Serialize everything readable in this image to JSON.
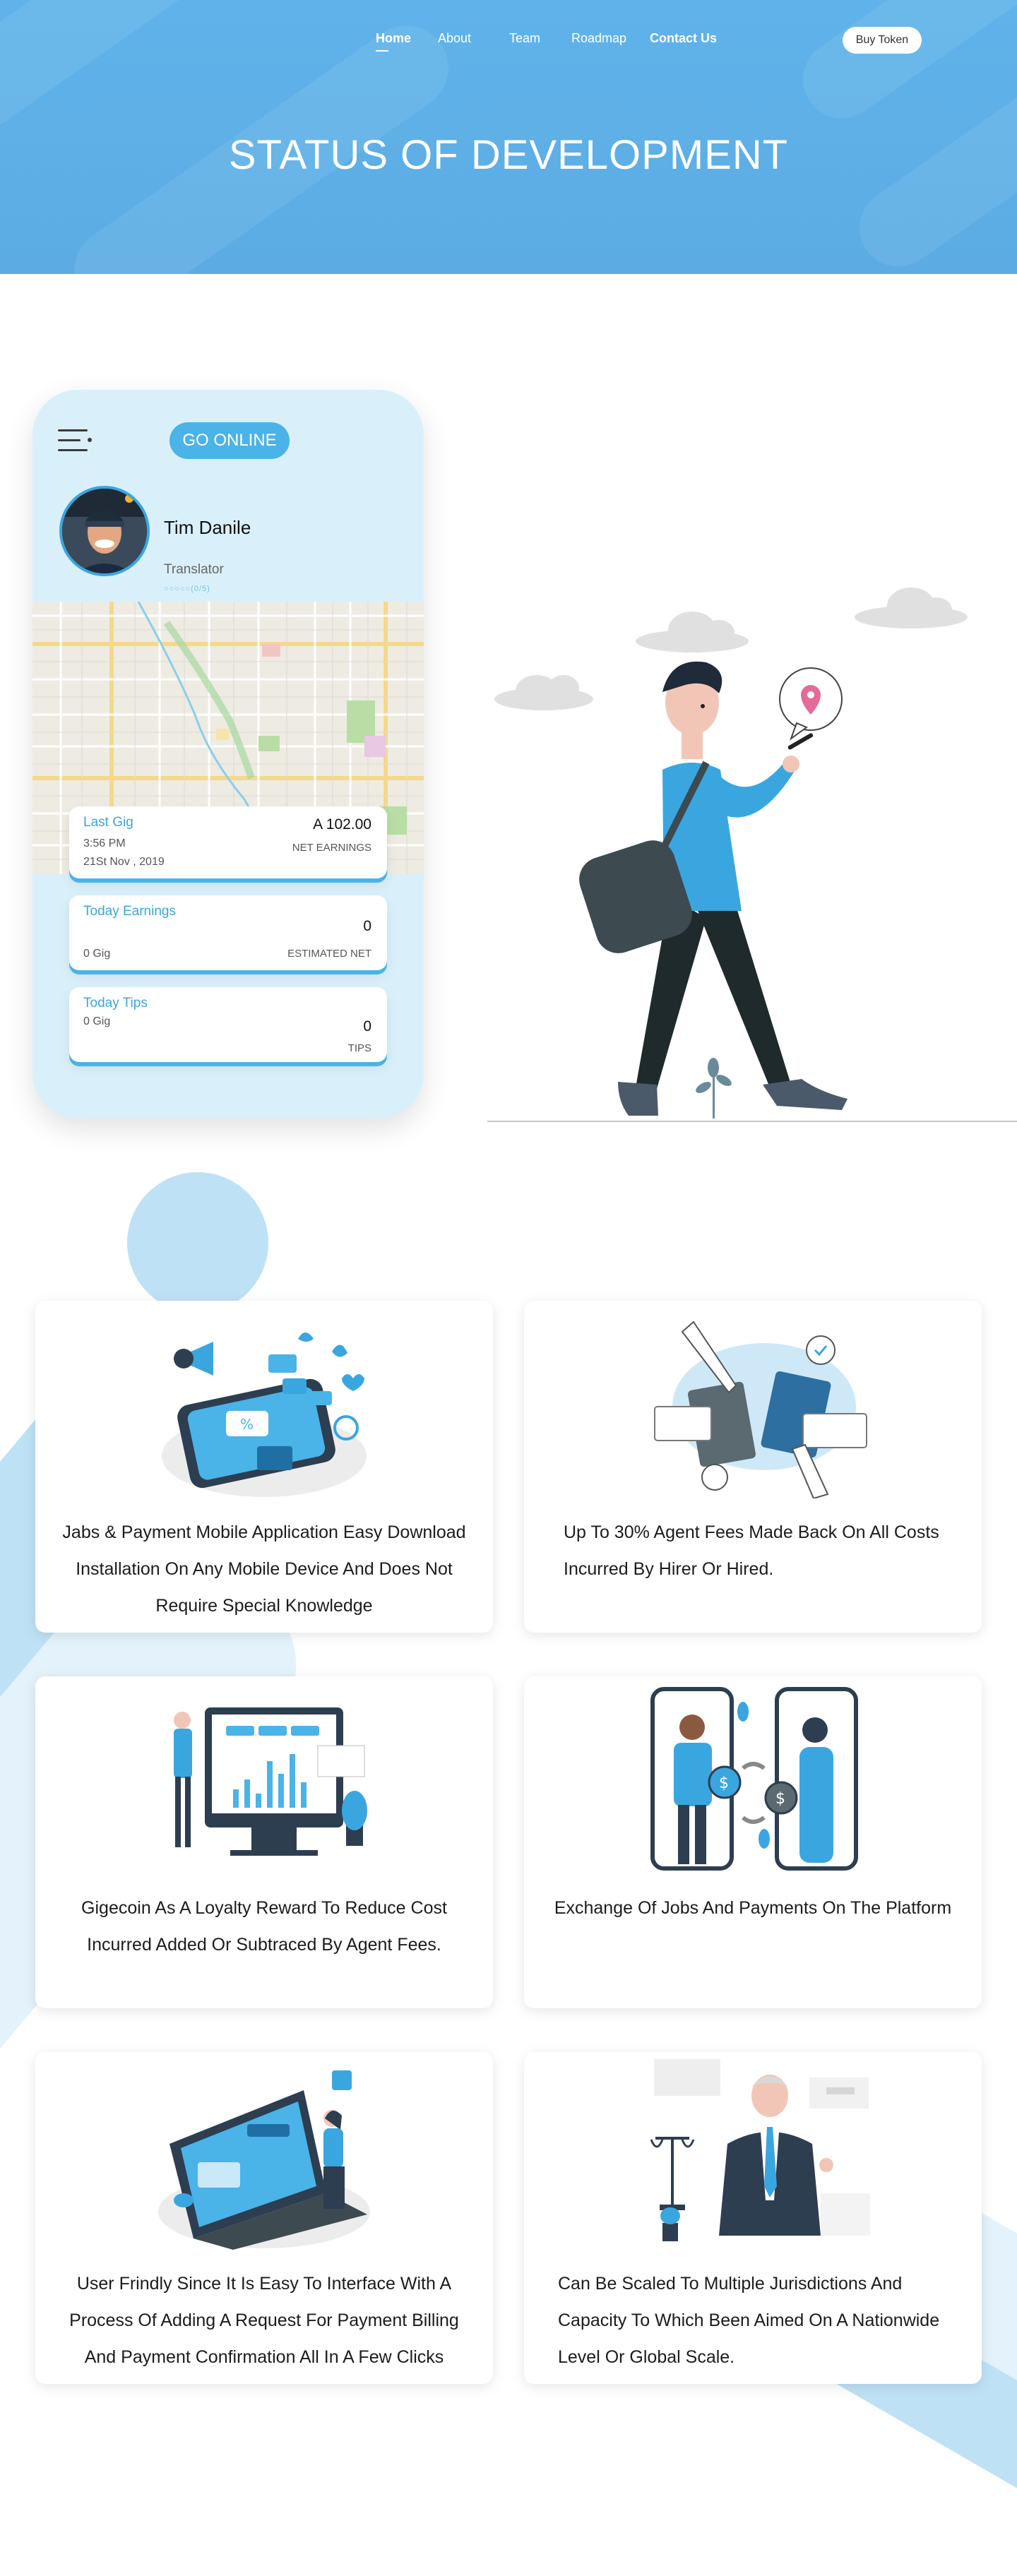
{
  "nav": {
    "links": [
      "Home",
      "About",
      "Team",
      "Roadmap",
      "Contact Us"
    ],
    "active": "Home",
    "cta": "Buy Token"
  },
  "hero": {
    "title": "STATUS OF DEVELOPMENT"
  },
  "phone": {
    "go_online": "GO ONLINE",
    "name": "Tim Danile",
    "role": "Translator",
    "rating": "○○○○○(0/5)",
    "last_gig": {
      "label": "Last Gig",
      "amount": "A 102.00",
      "time": "3:56 PM",
      "date": "21St Nov , 2019",
      "note": "NET EARNINGS"
    },
    "today_earnings": {
      "label": "Today Earnings",
      "value": "0",
      "gigs": "0 Gig",
      "note": "ESTIMATED NET"
    },
    "today_tips": {
      "label": "Today Tips",
      "gigs": "0 Gig",
      "value": "0",
      "note": "TIPS"
    }
  },
  "features": [
    {
      "lines": [
        "Jabs & Payment Mobile Application Easy Download",
        "Installation On Any Mobile Device And Does Not",
        "Require Special Knowledge"
      ],
      "illustration": "phone-marketing-illustration"
    },
    {
      "lines": [
        "Up To 30% Agent Fees Made Back On All Costs",
        "Incurred By Hirer Or Hired."
      ],
      "illustration": "money-exchange-illustration"
    },
    {
      "lines": [
        "Gigecoin As A Loyalty Reward To Reduce Cost",
        "Incurred Added Or Subtraced By Agent Fees."
      ],
      "illustration": "analytics-screen-illustration"
    },
    {
      "lines": [
        "Exchange Of Jobs And Payments On The Platform"
      ],
      "illustration": "phones-payment-illustration"
    },
    {
      "lines": [
        "User Frindly Since It Is Easy To Interface With A",
        "Process Of Adding A Request For Payment Billing",
        "And Payment Confirmation All In A Few Clicks"
      ],
      "illustration": "laptop-interface-illustration"
    },
    {
      "lines": [
        "Can Be Scaled To Multiple Jurisdictions And",
        "Capacity To Which Been Aimed On A Nationwide",
        "Level Or Global Scale."
      ],
      "illustration": "lawyer-illustration"
    }
  ],
  "colors": {
    "primary": "#4ab3e8",
    "hero": "#5fb3ea",
    "light": "#d9f0fb"
  }
}
